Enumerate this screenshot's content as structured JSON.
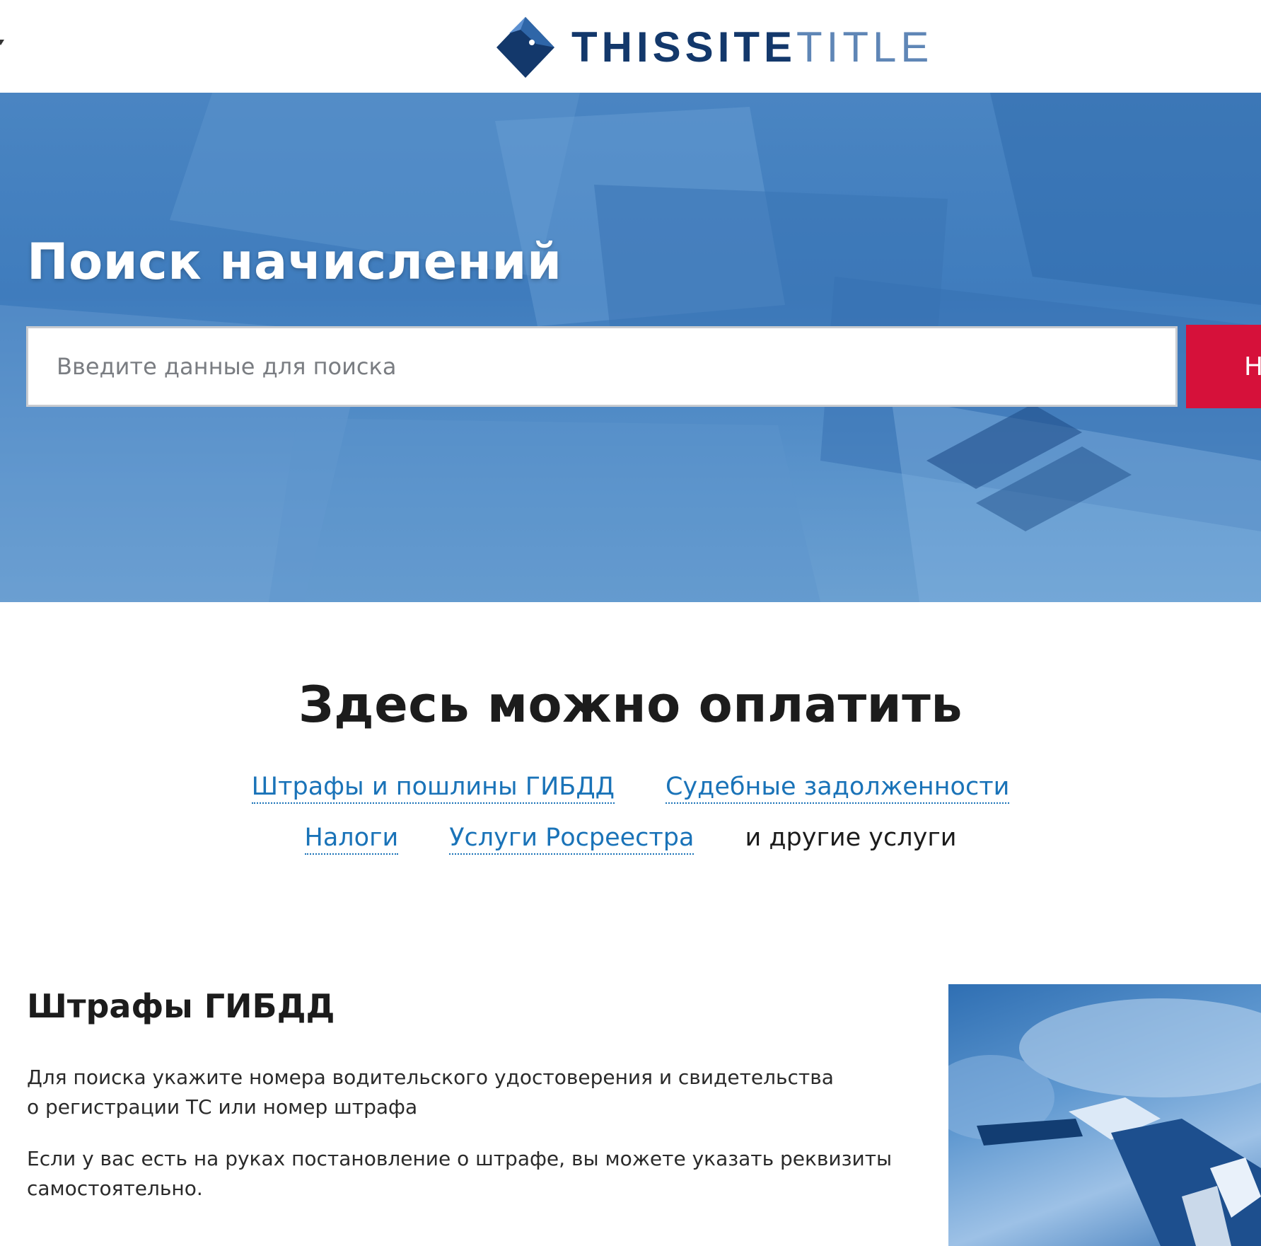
{
  "header": {
    "logo_bold": "THISSITE",
    "logo_light": "TITLE"
  },
  "hero": {
    "title": "Поиск начислений",
    "search_placeholder": "Введите данные для поиска",
    "search_value": "",
    "search_button_label": "Н"
  },
  "services": {
    "title": "Здесь можно оплатить",
    "links": [
      {
        "label": "Штрафы и пошлины ГИБДД"
      },
      {
        "label": "Судебные задолженности"
      },
      {
        "label": "Налоги"
      },
      {
        "label": "Услуги Росреестра"
      }
    ],
    "more_text": "и другие услуги"
  },
  "fines": {
    "title": "Штрафы ГИБДД",
    "paragraph1_line1": "Для поиска укажите номера водительского удостоверения и свидетельства",
    "paragraph1_line2": "о регистрации ТС или номер штрафа",
    "paragraph2_line1": "Если у вас есть на руках постановление о штрафе, вы можете указать реквизиты",
    "paragraph2_line2": "самостоятельно."
  },
  "colors": {
    "brand_dark": "#13386b",
    "brand_light": "#5f86b6",
    "hero_blue": "#3f7cbd",
    "button_red": "#d6113a",
    "link_blue": "#1a73b8"
  },
  "icons": {
    "logo": "diamond-logo-icon",
    "menu": "caret-down-icon"
  }
}
